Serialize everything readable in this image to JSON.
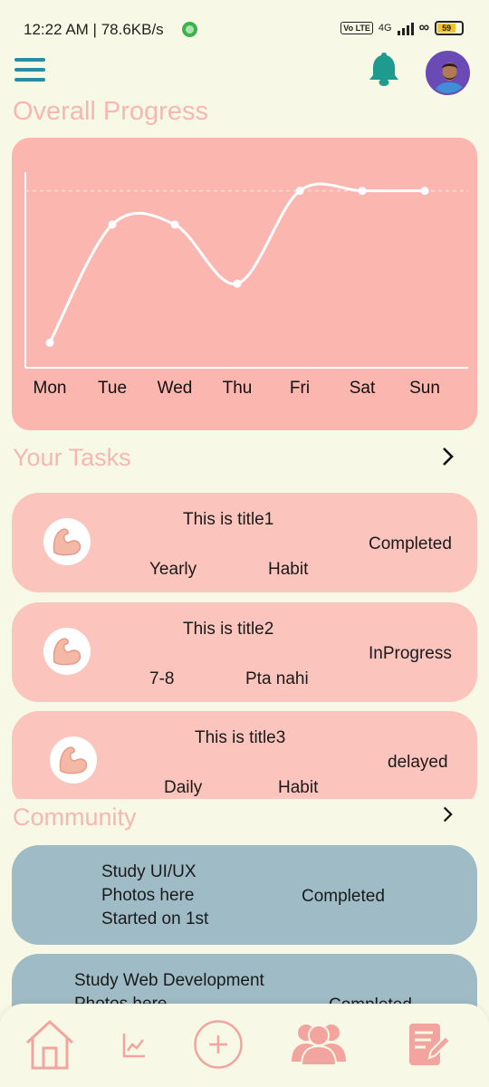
{
  "status_bar": {
    "time_speed": "12:22 AM | 78.6KB/s",
    "network": "4G",
    "volte": "Vo LTE",
    "battery": "59"
  },
  "header": {
    "menu_icon": "hamburger-icon",
    "notification_icon": "bell-icon",
    "avatar": "profile-avatar"
  },
  "overall_progress": {
    "title": "Overall Progress"
  },
  "chart_data": {
    "type": "line",
    "categories": [
      "Mon",
      "Tue",
      "Wed",
      "Thu",
      "Fri",
      "Sat",
      "Sun"
    ],
    "values": [
      1,
      8,
      8,
      4.5,
      10,
      10,
      10
    ],
    "ylim": [
      0,
      11
    ],
    "grid": false,
    "title": "",
    "xlabel": "",
    "ylabel": ""
  },
  "tasks": {
    "title": "Your Tasks",
    "items": [
      {
        "title": "This is title1",
        "status": "Completed",
        "tag1": "Yearly",
        "tag2": "Habit"
      },
      {
        "title": "This is title2",
        "status": "InProgress",
        "tag1": "7-8",
        "tag2": "Pta nahi"
      },
      {
        "title": "This is title3",
        "status": "delayed",
        "tag1": "Daily",
        "tag2": "Habit"
      }
    ]
  },
  "community": {
    "title": "Community",
    "items": [
      {
        "line1": "Study UI/UX",
        "line2": "Photos here",
        "line3": "Started on 1st",
        "status": "Completed"
      },
      {
        "line1": "Study Web Development",
        "line2": "Photos here",
        "line3": "",
        "status": "Completed"
      }
    ]
  },
  "colors": {
    "background": "#f8f8e6",
    "accent_pink": "#fbb6b0",
    "task_card": "#fbc4bc",
    "community_card": "#9fbcc6",
    "title_pink": "#f7b7b0",
    "nav_pink": "#f2a49f",
    "teal": "#2a8da8"
  },
  "bottom_nav": {
    "items": [
      "home-icon",
      "stats-icon",
      "add-icon",
      "community-icon",
      "notes-icon"
    ]
  }
}
